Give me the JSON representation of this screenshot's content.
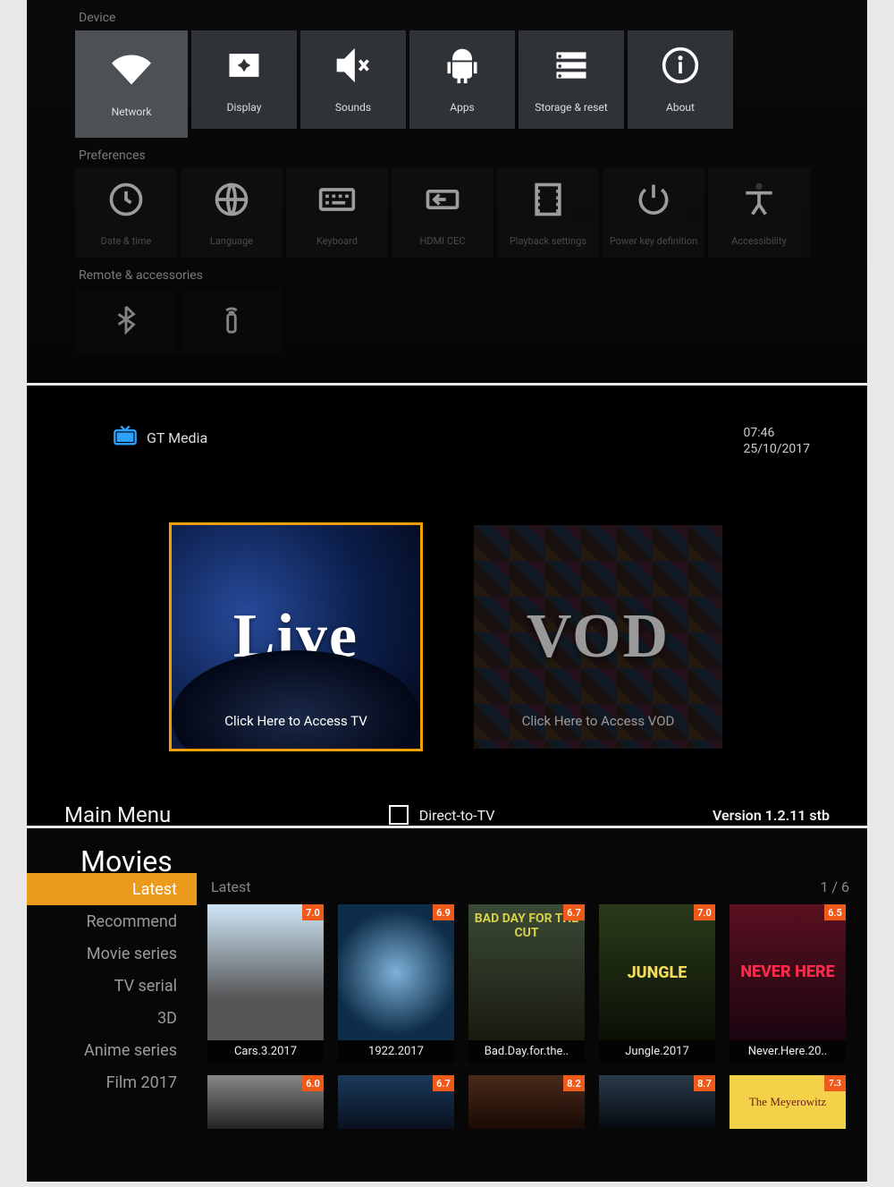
{
  "settings": {
    "sections": {
      "device": "Device",
      "preferences": "Preferences",
      "remote": "Remote & accessories"
    },
    "device": [
      {
        "id": "network",
        "label": "Network"
      },
      {
        "id": "display",
        "label": "Display"
      },
      {
        "id": "sounds",
        "label": "Sounds"
      },
      {
        "id": "apps",
        "label": "Apps"
      },
      {
        "id": "storage",
        "label": "Storage & reset"
      },
      {
        "id": "about",
        "label": "About"
      }
    ],
    "preferences": [
      {
        "id": "datetime",
        "label": "Date & time"
      },
      {
        "id": "language",
        "label": "Language"
      },
      {
        "id": "keyboard",
        "label": "Keyboard"
      },
      {
        "id": "hdmicec",
        "label": "HDMI CEC"
      },
      {
        "id": "playback",
        "label": "Playback settings"
      },
      {
        "id": "powerkey",
        "label": "Power key definition"
      },
      {
        "id": "accessibility",
        "label": "Accessibility"
      }
    ]
  },
  "gtmedia": {
    "brand": "GT Media",
    "time": "07:46",
    "date": "25/10/2017",
    "live_big": "Live",
    "live_caption": "Click Here to Access TV",
    "vod_big": "VOD",
    "vod_caption": "Click Here to Access VOD",
    "main_menu": "Main Menu",
    "direct_tv": "Direct-to-TV",
    "version": "Version 1.2.11 stb"
  },
  "movies": {
    "title": "Movies",
    "subtitle": "Latest",
    "page": "1 / 6",
    "side": [
      "Latest",
      "Recommend",
      "Movie series",
      "TV serial",
      "3D",
      "Anime series",
      "Film  2017"
    ],
    "row1": [
      {
        "name": "Cars.3.2017",
        "rating": "7.0",
        "art": "cars"
      },
      {
        "name": "1922.2017",
        "rating": "6.9",
        "art": "y1922"
      },
      {
        "name": "Bad.Day.for.the..",
        "rating": "6.7",
        "art": "badday",
        "artLabel": "BAD DAY FOR THE CUT"
      },
      {
        "name": "Jungle.2017",
        "rating": "7.0",
        "art": "jungle",
        "artLabel": "JUNGLE"
      },
      {
        "name": "Never.Here.20..",
        "rating": "6.5",
        "art": "never",
        "artLabel": "NEVER HERE"
      }
    ],
    "row2": [
      {
        "rating": "6.0",
        "art": "r6"
      },
      {
        "rating": "6.7",
        "art": "r7"
      },
      {
        "rating": "8.2",
        "art": "r8"
      },
      {
        "rating": "8.7",
        "art": "r9"
      },
      {
        "rating": "7.3",
        "art": "meyer",
        "artLabel": "The Meyerowitz"
      }
    ]
  }
}
